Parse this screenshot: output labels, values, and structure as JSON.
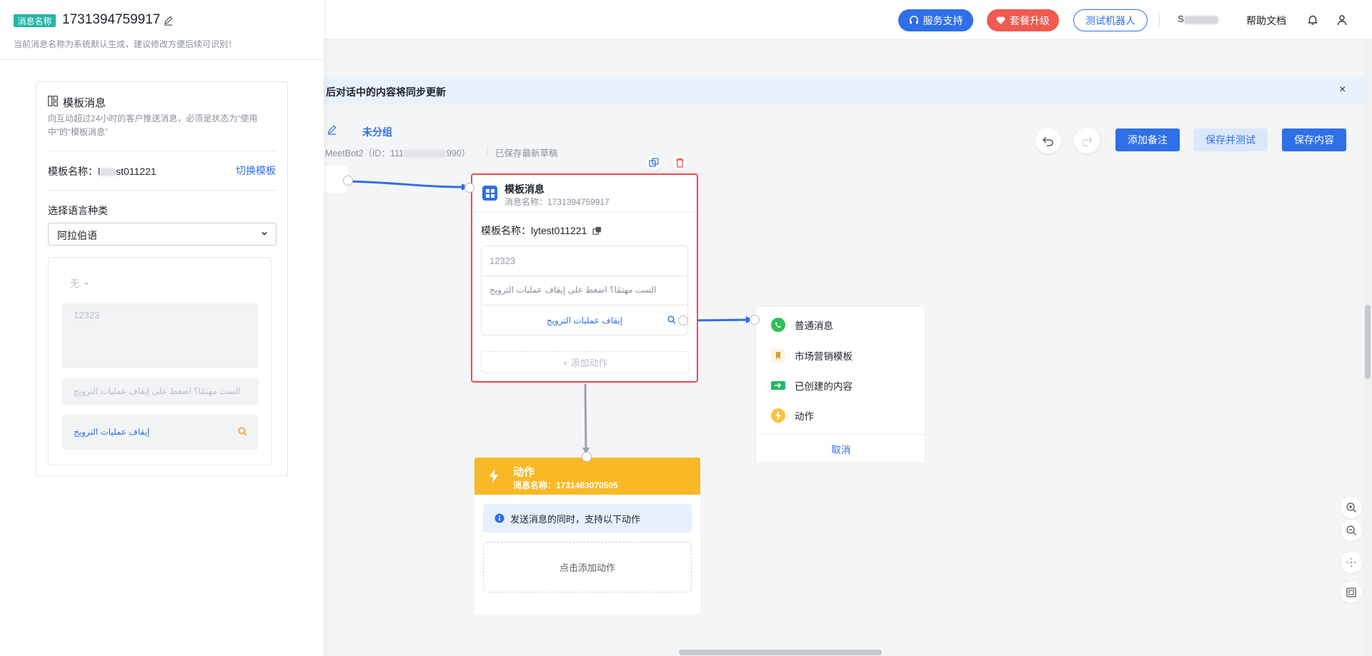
{
  "header": {
    "support": "服务支持",
    "upgrade": "套餐升级",
    "test_bot": "测试机器人",
    "user_initial": "S",
    "help": "帮助文档"
  },
  "notice": {
    "text": "后对话中的内容将同步更新",
    "close": "×"
  },
  "canvas": {
    "group": "未分组",
    "bot_info_prefix": ": MeetBot2（ID：111",
    "bot_info_suffix": "990）",
    "saved": "已保存最新草稿",
    "add_note": "添加备注",
    "save_test": "保存并测试",
    "save": "保存内容"
  },
  "template_node": {
    "title": "模板消息",
    "subtitle": "消息名称：1731394759917",
    "template_name": "模板名称：lytest011221",
    "body": "12323",
    "footer": "الست مهتمًا؟ اضغط على إيقاف عمليات الترويج",
    "button": "إيقاف عمليات الترويج",
    "add_action": "+ 添加动作"
  },
  "action_node": {
    "title": "动作",
    "subtitle": "消息名称：1731483070505",
    "info": "发送消息的同时，支持以下动作",
    "add": "点击添加动作"
  },
  "menu": {
    "items": [
      {
        "label": "普通消息",
        "icon": "whatsapp-icon"
      },
      {
        "label": "市场营销模板",
        "icon": "bookmark-icon"
      },
      {
        "label": "已创建的内容",
        "icon": "content-icon"
      },
      {
        "label": "动作",
        "icon": "lightning-icon"
      }
    ],
    "cancel": "取消"
  },
  "panel": {
    "name_tag": "消息名称",
    "name_value": "1731394759917",
    "name_hint": "当前消息名称为系统默认生成，建议修改方便后续可识别！",
    "section_title": "模板消息",
    "section_desc": "向互动超过24小时的客户推送消息，必须是状态为“使用中”的“模板消息”",
    "template_label": "模板名称：l",
    "template_suffix": "st011221",
    "switch": "切换模板",
    "lang_label": "选择语言种类",
    "lang_value": "阿拉伯语",
    "preview_header": "无",
    "preview_body": "12323",
    "preview_footer": "الست مهتمًا؟ اضغط على إيقاف عمليات الترويج",
    "preview_button": "إيقاف عمليات الترويج"
  },
  "colors": {
    "primary": "#2f6fe8",
    "danger": "#ef4b4b",
    "action": "#f9b926",
    "teal": "#27b5a6"
  }
}
